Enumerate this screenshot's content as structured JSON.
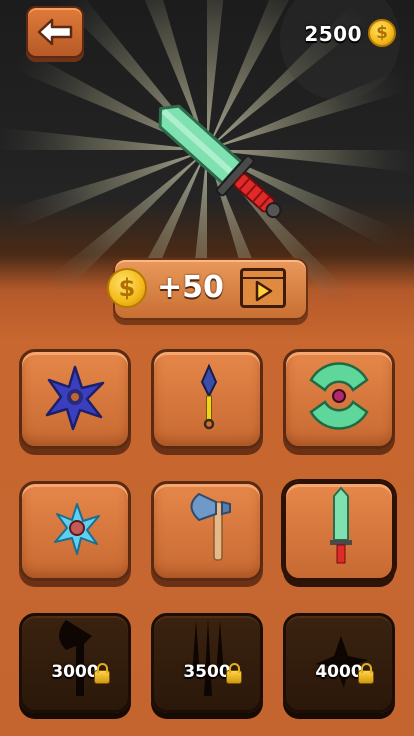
{
  "header": {
    "back_icon": "arrow-left-icon",
    "coins": "2500",
    "coin_icon": "dollar-coin-icon"
  },
  "featured": {
    "item_icon": "green-sword-icon"
  },
  "reward": {
    "amount": "+50",
    "coin_icon": "dollar-coin-icon",
    "video_icon": "video-play-icon"
  },
  "items": [
    {
      "icon": "blue-shuriken-icon",
      "state": "unlocked"
    },
    {
      "icon": "kunai-icon",
      "state": "unlocked"
    },
    {
      "icon": "green-disc-blade-icon",
      "state": "unlocked"
    },
    {
      "icon": "cyan-shuriken-icon",
      "state": "unlocked"
    },
    {
      "icon": "axe-icon",
      "state": "unlocked"
    },
    {
      "icon": "green-sword-icon",
      "state": "selected"
    },
    {
      "icon": "locked-axe-silhouette-icon",
      "state": "locked",
      "price": "3000"
    },
    {
      "icon": "locked-trident-silhouette-icon",
      "state": "locked",
      "price": "3500"
    },
    {
      "icon": "locked-shuriken-silhouette-icon",
      "state": "locked",
      "price": "4000"
    }
  ],
  "colors": {
    "wood": "#d97a3d",
    "wood_dark": "#5a2a12",
    "coin": "#f3b91a",
    "locked_tile": "#2b180a"
  }
}
